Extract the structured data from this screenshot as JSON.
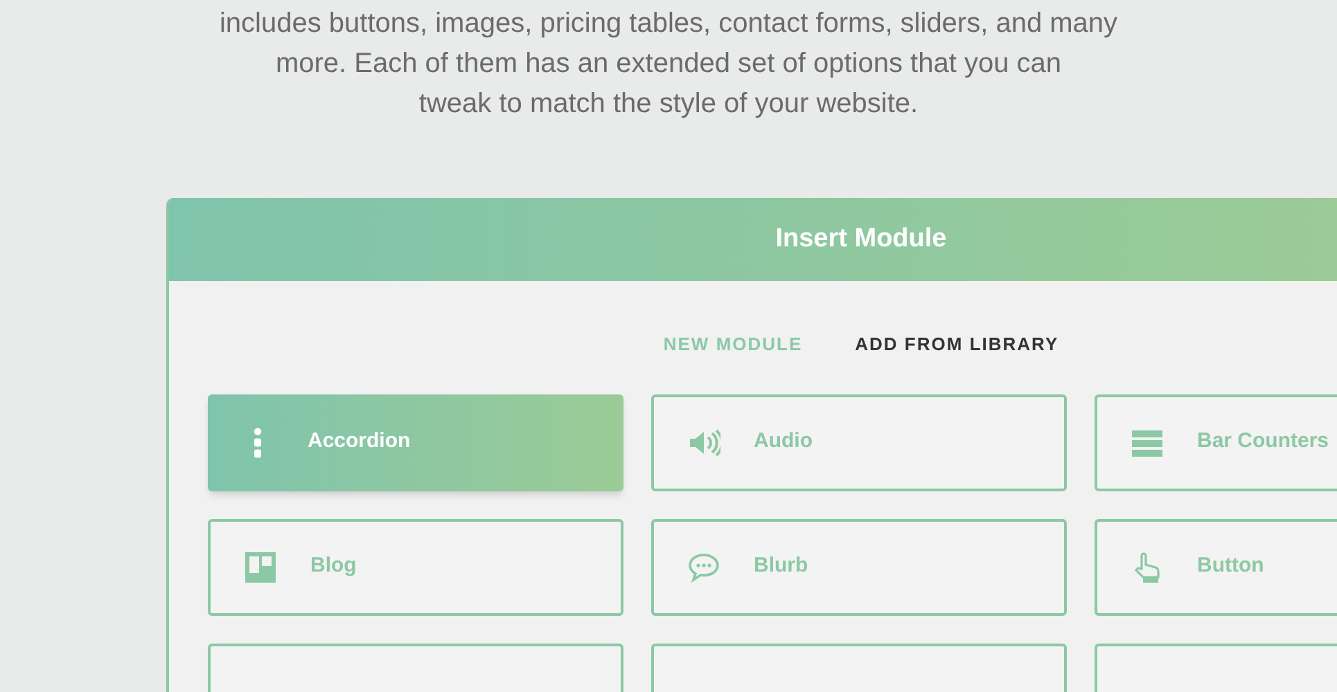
{
  "intro": {
    "lines": [
      "includes buttons, images, pricing tables, contact forms, sliders, and many",
      "more. Each of them has an extended set of options that you can",
      "tweak to match the style of your website."
    ]
  },
  "modal": {
    "title": "Insert Module",
    "tabs": [
      {
        "label": "NEW MODULE",
        "selected": true
      },
      {
        "label": "ADD FROM LIBRARY",
        "selected": false
      }
    ],
    "modules": [
      {
        "label": "Accordion",
        "kind": "accordion",
        "selected": true
      },
      {
        "label": "Audio",
        "kind": "audio",
        "selected": false
      },
      {
        "label": "Bar Counters",
        "kind": "bars",
        "selected": false
      },
      {
        "label": "Blog",
        "kind": "blog",
        "selected": false
      },
      {
        "label": "Blurb",
        "kind": "blurb",
        "selected": false
      },
      {
        "label": "Button",
        "kind": "button",
        "selected": false
      }
    ]
  }
}
